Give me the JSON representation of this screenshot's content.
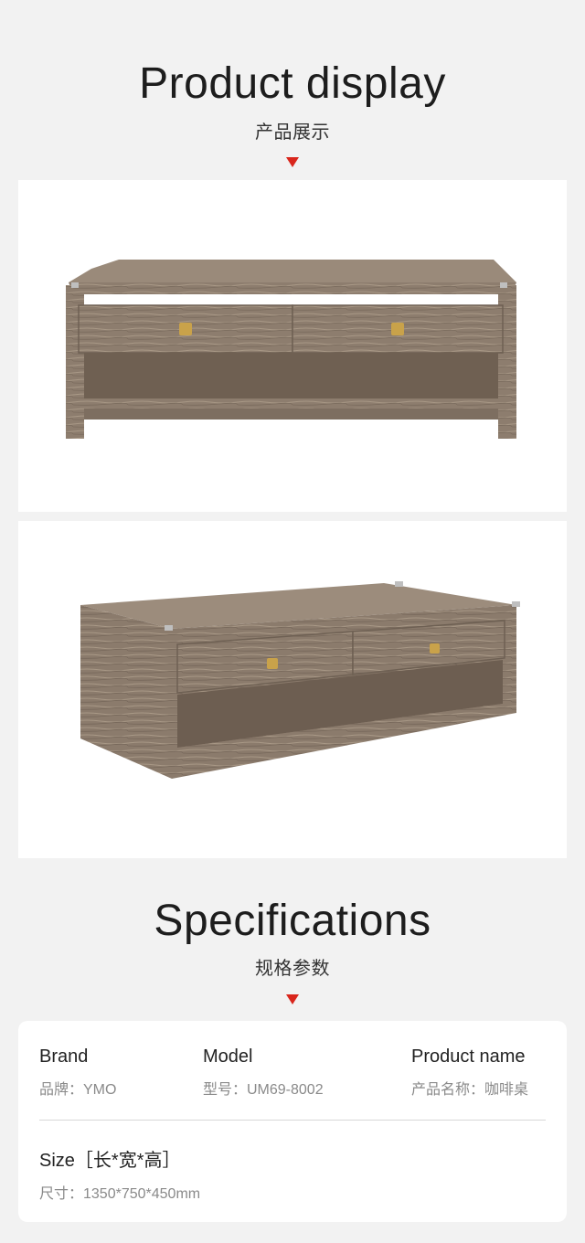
{
  "display": {
    "title": "Product display",
    "subtitle": "产品展示"
  },
  "specifications": {
    "title": "Specifications",
    "subtitle": "规格参数",
    "brand": {
      "label": "Brand",
      "value": "品牌：YMO"
    },
    "model": {
      "label": "Model",
      "value": "型号：UM69-8002"
    },
    "product_name": {
      "label": "Product name",
      "value": "产品名称：咖啡桌"
    },
    "size": {
      "label": "Size［长*宽*高］",
      "value": "尺寸：1350*750*450mm"
    }
  },
  "colors": {
    "accent": "#d9261c",
    "background": "#f2f2f2",
    "card": "#ffffff",
    "wood": "#8f7f6f"
  }
}
